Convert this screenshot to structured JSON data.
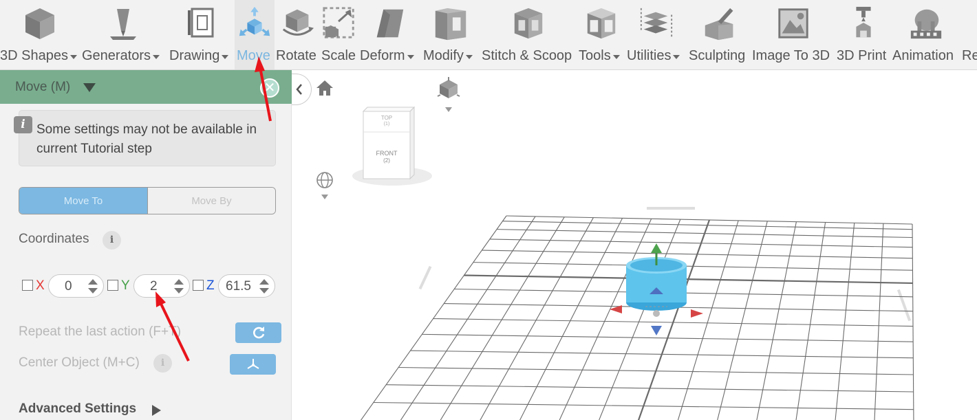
{
  "toolbar": {
    "items": [
      {
        "label": "3D Shapes",
        "icon": "cube-icon",
        "dropdown": true
      },
      {
        "label": "Generators",
        "icon": "generator-icon",
        "dropdown": true
      },
      {
        "label": "Drawing",
        "icon": "drawing-icon",
        "dropdown": true
      },
      {
        "label": "Move",
        "icon": "move-icon",
        "dropdown": false,
        "active": true
      },
      {
        "label": "Rotate",
        "icon": "rotate-icon",
        "dropdown": false
      },
      {
        "label": "Scale",
        "icon": "scale-icon",
        "dropdown": false
      },
      {
        "label": "Deform",
        "icon": "deform-icon",
        "dropdown": true
      },
      {
        "label": "Modify",
        "icon": "modify-icon",
        "dropdown": true
      },
      {
        "label": "Stitch & Scoop",
        "icon": "stitch-scoop-icon",
        "dropdown": false
      },
      {
        "label": "Tools",
        "icon": "tools-icon",
        "dropdown": true
      },
      {
        "label": "Utilities",
        "icon": "utilities-icon",
        "dropdown": true
      },
      {
        "label": "Sculpting",
        "icon": "sculpting-icon",
        "dropdown": false
      },
      {
        "label": "Image To 3D",
        "icon": "image-to-3d-icon",
        "dropdown": false
      },
      {
        "label": "3D Print",
        "icon": "3d-print-icon",
        "dropdown": false
      },
      {
        "label": "Animation",
        "icon": "animation-icon",
        "dropdown": false
      },
      {
        "label": "Re",
        "icon": "",
        "dropdown": false
      }
    ]
  },
  "panel": {
    "title": "Move (M)",
    "close_glyph": "✕",
    "notice_icon": "i",
    "notice_text": "Some settings may not be available in current Tutorial step",
    "mode_tabs": {
      "move_to": "Move To",
      "move_by": "Move By"
    },
    "coordinates_label": "Coordinates",
    "info_glyph": "i",
    "coords": {
      "x": {
        "axis": "X",
        "value": "0",
        "color": "#e53935"
      },
      "y": {
        "axis": "Y",
        "value": "2",
        "color": "#43a047"
      },
      "z": {
        "axis": "Z",
        "value": "61.5",
        "color": "#1e56d8"
      }
    },
    "repeat_label": "Repeat the last action (F+T)",
    "center_label": "Center Object (M+C)",
    "advanced_label": "Advanced Settings"
  },
  "viewport": {
    "view_cube": {
      "top": "TOP",
      "top_num": "(1)",
      "front": "FRONT",
      "front_num": "(2)"
    },
    "object_color": "#5ec4ec"
  },
  "colors": {
    "accent_blue": "#7cb8e2",
    "header_green": "#79ad8e",
    "annotation_red": "#e8141b"
  }
}
